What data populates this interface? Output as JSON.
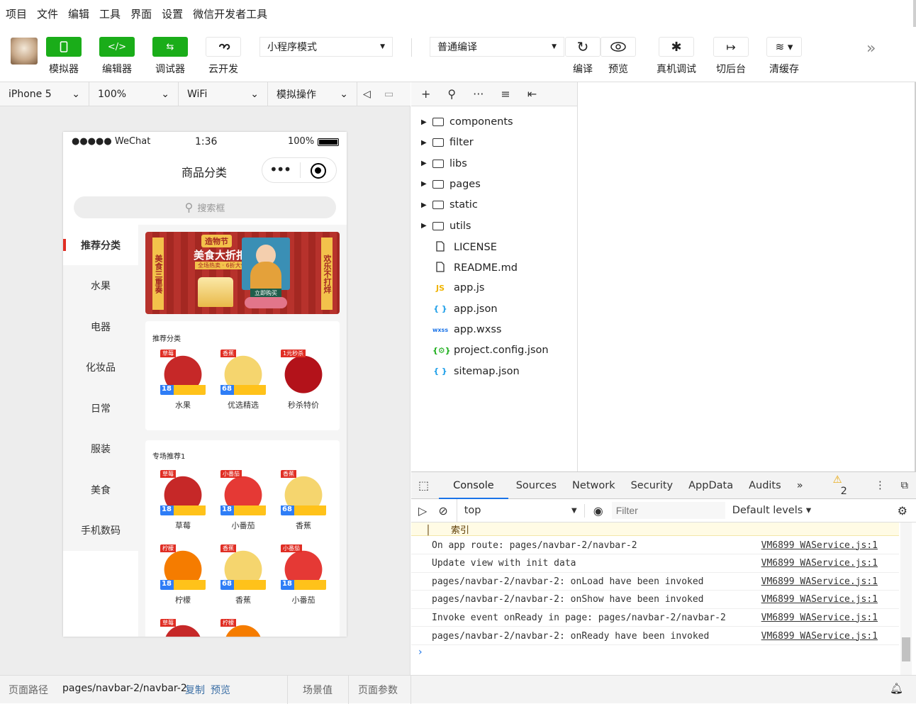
{
  "menu": [
    "项目",
    "文件",
    "编辑",
    "工具",
    "界面",
    "设置",
    "微信开发者工具"
  ],
  "toolbar": {
    "simulator": "模拟器",
    "editor": "编辑器",
    "debugger": "调试器",
    "cloud": "云开发",
    "mode": "小程序模式",
    "compile_mode": "普通编译",
    "compile": "编译",
    "preview": "预览",
    "remote_debug": "真机调试",
    "background": "切后台",
    "clear_cache": "清缓存"
  },
  "simbar": {
    "device": "iPhone 5",
    "zoom": "100%",
    "network": "WiFi",
    "operation": "模拟操作"
  },
  "phone": {
    "carrier": "●●●●● WeChat",
    "time": "1:36",
    "battery": "100%",
    "nav_title": "商品分类",
    "search_placeholder": "搜索框",
    "categories": [
      "推荐分类",
      "水果",
      "电器",
      "化妆品",
      "日常",
      "服装",
      "美食",
      "手机数码"
    ],
    "banner": {
      "badge": "造物节",
      "headline": "美食大折扣",
      "subline": "全场热卖 · 6折大促销",
      "left_vertical": "美食三重奏",
      "right_vertical": "欢乐不打烊",
      "button": "立即购买"
    },
    "section1": {
      "title": "推荐分类",
      "items": [
        {
          "label": "水果",
          "tag": "草莓",
          "price": "18",
          "color": "#c62828"
        },
        {
          "label": "优选精选",
          "tag": "香蕉",
          "price": "68",
          "color": "#f5d56e"
        },
        {
          "label": "秒杀特价",
          "tag": "1元秒杀",
          "price": "",
          "color": "#b3121a"
        }
      ]
    },
    "section2": {
      "title": "专场推荐1",
      "items": [
        {
          "label": "草莓",
          "tag": "草莓",
          "price": "18",
          "color": "#c62828"
        },
        {
          "label": "小番茄",
          "tag": "小番茄",
          "price": "18",
          "color": "#e53935"
        },
        {
          "label": "香蕉",
          "tag": "香蕉",
          "price": "68",
          "color": "#f5d56e"
        },
        {
          "label": "柠檬",
          "tag": "柠檬",
          "price": "18",
          "color": "#f57c00"
        },
        {
          "label": "香蕉",
          "tag": "香蕉",
          "price": "68",
          "color": "#f5d56e"
        },
        {
          "label": "小番茄",
          "tag": "小番茄",
          "price": "18",
          "color": "#e53935"
        },
        {
          "label": "",
          "tag": "草莓",
          "price": "",
          "color": "#c62828"
        },
        {
          "label": "",
          "tag": "柠檬",
          "price": "",
          "color": "#f57c00"
        }
      ]
    }
  },
  "filetree": [
    {
      "name": "components",
      "type": "folder"
    },
    {
      "name": "filter",
      "type": "folder"
    },
    {
      "name": "libs",
      "type": "folder"
    },
    {
      "name": "pages",
      "type": "folder"
    },
    {
      "name": "static",
      "type": "folder"
    },
    {
      "name": "utils",
      "type": "folder"
    },
    {
      "name": "LICENSE",
      "type": "file",
      "icon": ""
    },
    {
      "name": "README.md",
      "type": "file",
      "icon": ""
    },
    {
      "name": "app.js",
      "type": "file",
      "icon": "JS"
    },
    {
      "name": "app.json",
      "type": "file",
      "icon": "{ }"
    },
    {
      "name": "app.wxss",
      "type": "file",
      "icon": "wxss"
    },
    {
      "name": "project.config.json",
      "type": "file",
      "icon": "{⚙}"
    },
    {
      "name": "sitemap.json",
      "type": "file",
      "icon": "{ }"
    }
  ],
  "devtools": {
    "tabs": [
      "Console",
      "Sources",
      "Network",
      "Security",
      "AppData",
      "Audits"
    ],
    "warnings": "2",
    "context": "top",
    "filter_placeholder": "Filter",
    "levels": "Default levels",
    "warning_line": "索引",
    "logs": [
      {
        "msg": "On app route: pages/navbar-2/navbar-2",
        "src": "VM6899 WAService.js:1"
      },
      {
        "msg": "Update view with init data",
        "src": "VM6899 WAService.js:1"
      },
      {
        "msg": "pages/navbar-2/navbar-2: onLoad have been invoked",
        "src": "VM6899 WAService.js:1"
      },
      {
        "msg": "pages/navbar-2/navbar-2: onShow have been invoked",
        "src": "VM6899 WAService.js:1"
      },
      {
        "msg": "Invoke event onReady in page: pages/navbar-2/navbar-2",
        "src": "VM6899 WAService.js:1"
      },
      {
        "msg": "pages/navbar-2/navbar-2: onReady have been invoked",
        "src": "VM6899 WAService.js:1"
      }
    ],
    "prompt": "›"
  },
  "bottom": {
    "path_label": "页面路径",
    "path": "pages/navbar-2/navbar-2",
    "copy": "复制",
    "preview": "预览",
    "scene": "场景值",
    "params": "页面参数"
  },
  "colors": {
    "accent_green": "#1aad19",
    "active_category": "#e02e24",
    "banner": "#b7322c"
  }
}
